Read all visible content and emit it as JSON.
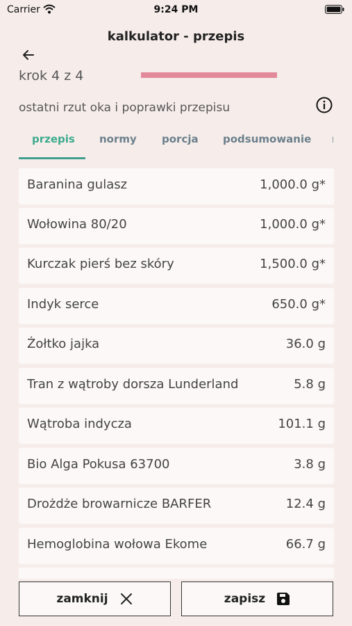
{
  "status": {
    "carrier": "Carrier",
    "time": "9:24 PM"
  },
  "header": {
    "title": "kalkulator - przepis"
  },
  "step": {
    "label": "krok 4 z 4",
    "progress": 1.0
  },
  "subtitle": "ostatni rzut oka i poprawki przepisu",
  "tabs": [
    {
      "label": "przepis"
    },
    {
      "label": "normy"
    },
    {
      "label": "porcja"
    },
    {
      "label": "podsumowanie"
    },
    {
      "label": "r"
    }
  ],
  "ingredients": [
    {
      "name": "Baranina gulasz",
      "amount": "1,000.0 g*"
    },
    {
      "name": "Wołowina 80/20",
      "amount": "1,000.0 g*"
    },
    {
      "name": "Kurczak pierś bez skóry",
      "amount": "1,500.0 g*"
    },
    {
      "name": "Indyk serce",
      "amount": "650.0 g*"
    },
    {
      "name": "Żołtko jajka",
      "amount": "36.0 g"
    },
    {
      "name": "Tran z wątroby dorsza Lunderland",
      "amount": "5.8 g"
    },
    {
      "name": "Wątroba indycza",
      "amount": "101.1 g"
    },
    {
      "name": "Bio Alga Pokusa 63700",
      "amount": "3.8 g"
    },
    {
      "name": "Drożdże browarnicze BARFER",
      "amount": "12.4 g"
    },
    {
      "name": "Hemoglobina wołowa Ekome",
      "amount": "66.7 g"
    }
  ],
  "buttons": {
    "close": "zamknij",
    "save": "zapisz"
  },
  "colors": {
    "accent": "#3daa8d",
    "progress": "#e28a9a",
    "background": "#f6edea"
  }
}
